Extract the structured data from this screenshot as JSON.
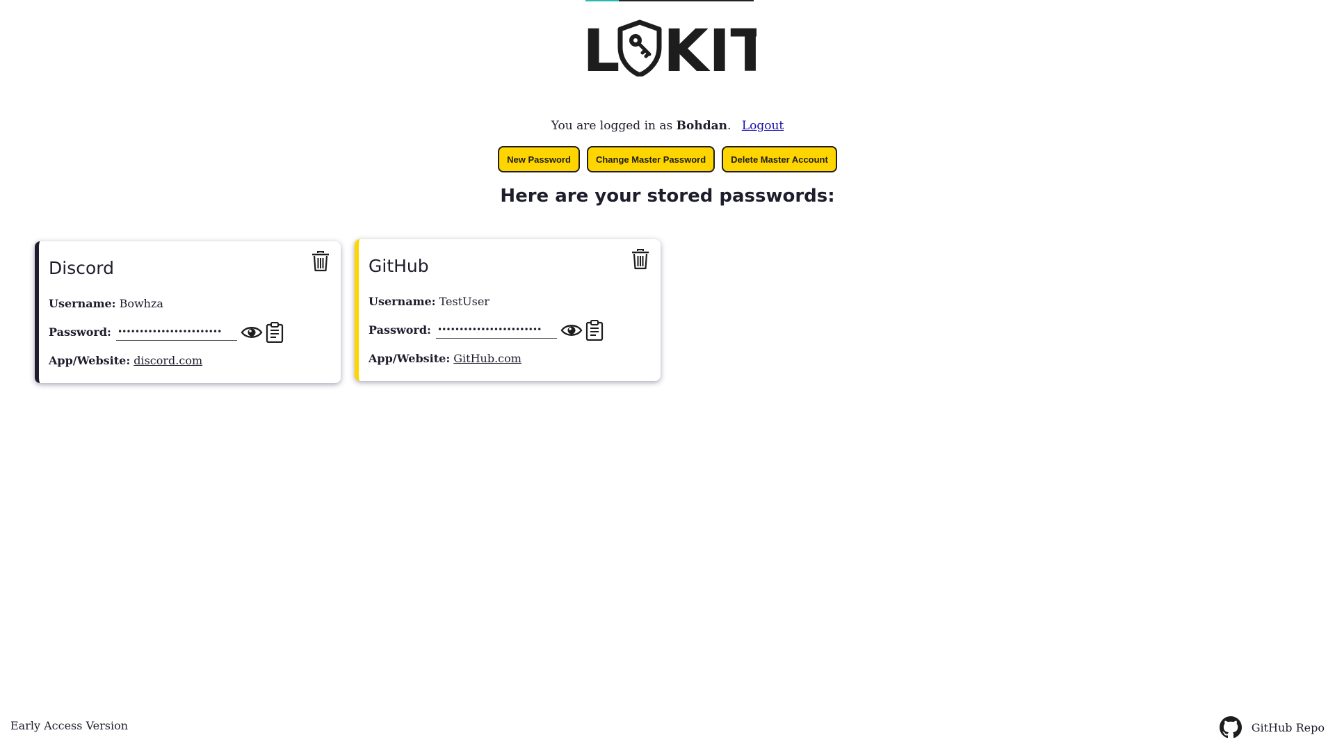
{
  "app": {
    "brand": "LOCKIT",
    "brand_left": "L",
    "brand_right": "KIT"
  },
  "status": {
    "prefix": "You are logged in as ",
    "username": "Bohdan",
    "suffix": ".",
    "logout_label": "Logout"
  },
  "actions": {
    "new_password": "New Password",
    "change_master": "Change Master Password",
    "delete_master": "Delete Master Account"
  },
  "heading": "Here are your stored passwords:",
  "labels": {
    "username": "Username:",
    "password": "Password:",
    "site": "App/Website:"
  },
  "passwords": [
    {
      "title": "Discord",
      "username": "Bowhza",
      "masked_password": "••••••••••••••••••••••••",
      "site": "discord.com",
      "accent": "#1d1d2c"
    },
    {
      "title": "GitHub",
      "username": "TestUser",
      "masked_password": "••••••••••••••••••••••••",
      "site": "GitHub.com",
      "accent": "#ffd500"
    }
  ],
  "footer": {
    "version": "Early Access Version",
    "repo_label": "GitHub Repo"
  },
  "icons": {
    "logo": "shield-key-icon",
    "delete": "trash-icon",
    "reveal": "eye-icon",
    "copy": "clipboard-icon",
    "repo": "github-icon"
  },
  "colors": {
    "accent_yellow": "#ffd500",
    "text_dark": "#1d1d2c",
    "link_blue": "#1a0dab",
    "teal": "#28b9b5"
  }
}
